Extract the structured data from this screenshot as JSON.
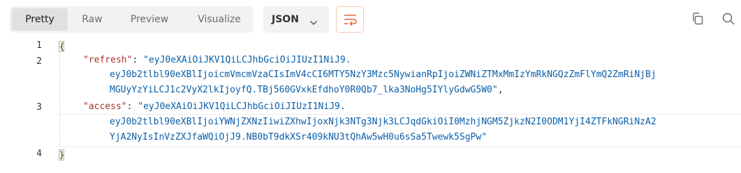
{
  "toolbar": {
    "tabs": [
      {
        "label": "Pretty",
        "active": true
      },
      {
        "label": "Raw",
        "active": false
      },
      {
        "label": "Preview",
        "active": false
      },
      {
        "label": "Visualize",
        "active": false
      }
    ],
    "format_select": {
      "value": "JSON",
      "icon": "chevron-down-icon"
    },
    "wrap_icon": "wrap-lines-icon",
    "copy_icon": "copy-icon",
    "search_icon": "search-icon",
    "accent_color": "#e8663d"
  },
  "editor": {
    "line_numbers": [
      "1",
      "2",
      "3",
      "4"
    ],
    "open_brace": "{",
    "close_brace": "}",
    "refresh": {
      "key": "\"refresh\"",
      "colon": ": ",
      "value_lines": [
        "\"eyJ0eXAiOiJKV1QiLCJhbGciOiJIUzI1NiJ9.",
        "eyJ0b2tlbl90eXBlIjoicmVmcmVzaCIsImV4cCI6MTY5NzY3Mzc5NywianRpIjoiZWNiZTMxMmIzYmRkNGQzZmFlYmQ2ZmRiNjBj",
        "MGUyYzYiLCJ1c2VyX2lkIjoyfQ.TBj560GVxkEfdhoY0R0Qb7_lka3NoHg5IYlyGdwG5W0\""
      ],
      "trailing": ","
    },
    "access": {
      "key": "\"access\"",
      "colon": ": ",
      "value_lines": [
        "\"eyJ0eXAiOiJKV1QiLCJhbGciOiJIUzI1NiJ9.",
        "eyJ0b2tlbl90eXBlIjoiYWNjZXNzIiwiZXhwIjoxNjk3NTg3Njk3LCJqdGkiOiI0MzhjNGM5ZjkzN2I0ODM1YjI4ZTFkNGRiNzA2",
        "YjA2NyIsInVzZXJfaWQiOjJ9.NB0bT9dkXSr409kNU3tQhAw5wH0u6sSa5Twewk5SgPw\""
      ]
    }
  }
}
